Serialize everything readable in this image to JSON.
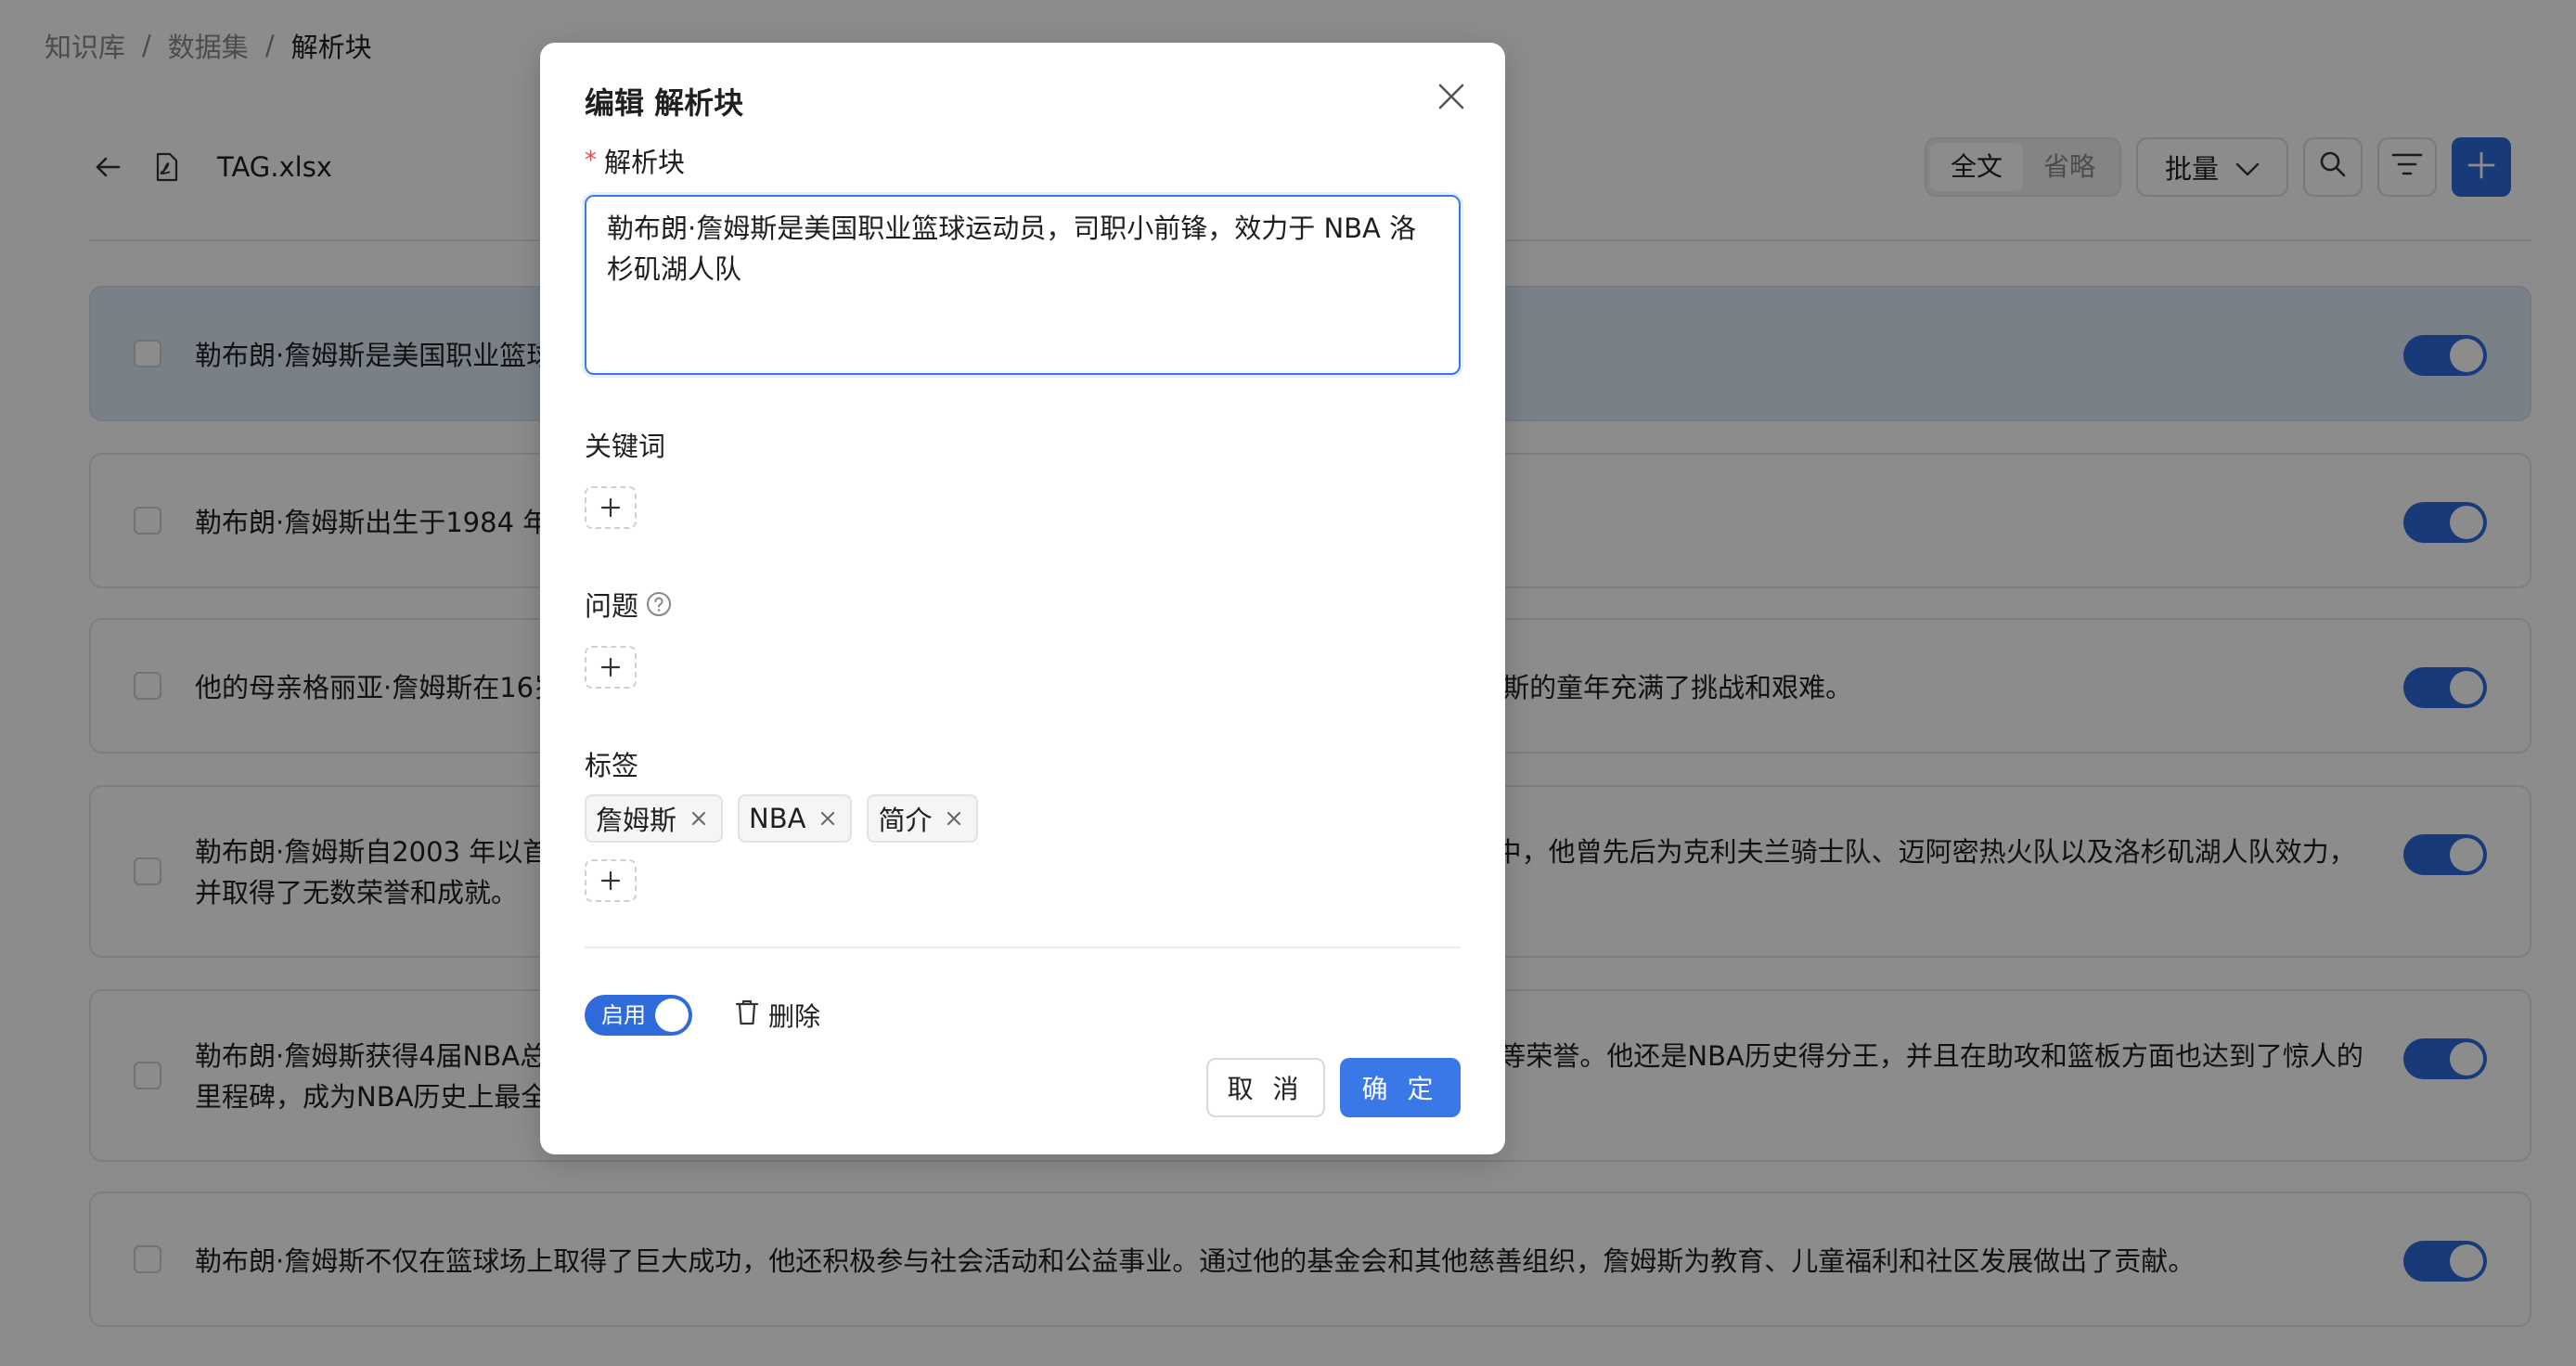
{
  "breadcrumb": {
    "items": [
      "知识库",
      "数据集",
      "解析块"
    ],
    "separator": "/"
  },
  "toolbar": {
    "file_name": "TAG.xlsx",
    "view_toggle": [
      "全文",
      "省略"
    ],
    "batch_label": "批量",
    "icons": [
      "back-arrow-icon",
      "file-icon",
      "search-icon",
      "filter-icon",
      "plus-icon"
    ]
  },
  "chunks": [
    {
      "text": "勒布朗·詹姆斯是美国职业篮球运动员，司职小前锋，效力于 NBA 洛杉矶湖人队",
      "enabled": true
    },
    {
      "text": "勒布朗·詹姆斯出生于1984 年12月30日，出生在美国俄亥俄州阿克伦市。",
      "enabled": true
    },
    {
      "text": "他的母亲格丽亚·詹姆斯在16岁时生下了他，他的父亲一直没有出现在他的生活中。母亲独自抚养他长大，詹姆斯的童年充满了挑战和艰难。",
      "enabled": true
    },
    {
      "text": "勒布朗·詹姆斯自2003 年以首轮第一顺位被克利夫兰骑士队选中，开始了他的NBA职业生涯。在他的职业生涯中，他曾先后为克利夫兰骑士队、迈阿密热火队以及洛杉矶湖人队效力，并取得了无数荣誉和成就。",
      "enabled": true
    },
    {
      "text": "勒布朗·詹姆斯获得4届NBA总冠军、4次NBA总决赛最有价值球员、4次常规赛最有价值球员以及多次全明星赛等荣誉。他还是NBA历史得分王，并且在助攻和篮板方面也达到了惊人的里程碑，成为NBA历史上最全面的球员之一。",
      "enabled": true
    },
    {
      "text": "勒布朗·詹姆斯不仅在篮球场上取得了巨大成功，他还积极参与社会活动和公益事业。通过他的基金会和其他慈善组织，詹姆斯为教育、儿童福利和社区发展做出了贡献。",
      "enabled": true
    }
  ],
  "modal": {
    "title": "编辑 解析块",
    "chunk_label": "解析块",
    "required_mark": "*",
    "chunk_value": "勒布朗·詹姆斯是美国职业篮球运动员，司职小前锋，效力于 NBA 洛杉矶湖人队",
    "keywords_label": "关键词",
    "questions_label": "问题",
    "tags_label": "标签",
    "tags": [
      "詹姆斯",
      "NBA",
      "简介"
    ],
    "enable_label": "启用",
    "enabled": true,
    "delete_label": "删除",
    "cancel_label": "取 消",
    "ok_label": "确 定"
  },
  "colors": {
    "primary": "#2f6bdb",
    "selected_row": "#dfe9f8",
    "danger_mark": "#e5484d"
  }
}
